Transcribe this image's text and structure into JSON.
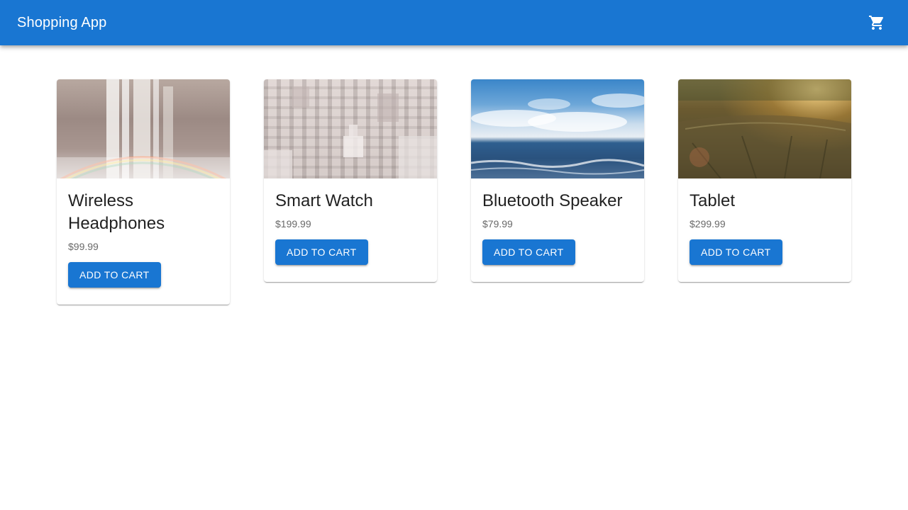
{
  "app": {
    "title": "Shopping App",
    "cart_icon": "shopping-cart-icon",
    "accent_color": "#1976d2"
  },
  "products": [
    {
      "name": "Wireless Headphones",
      "price": "$99.99",
      "button_label": "ADD TO CART",
      "image": "waterfall-with-rainbow"
    },
    {
      "name": "Smart Watch",
      "price": "$199.99",
      "button_label": "ADD TO CART",
      "image": "aerial-city-view"
    },
    {
      "name": "Bluetooth Speaker",
      "price": "$79.99",
      "button_label": "ADD TO CART",
      "image": "ocean-horizon-sky"
    },
    {
      "name": "Tablet",
      "price": "$299.99",
      "button_label": "ADD TO CART",
      "image": "tree-stump-sunset"
    }
  ]
}
